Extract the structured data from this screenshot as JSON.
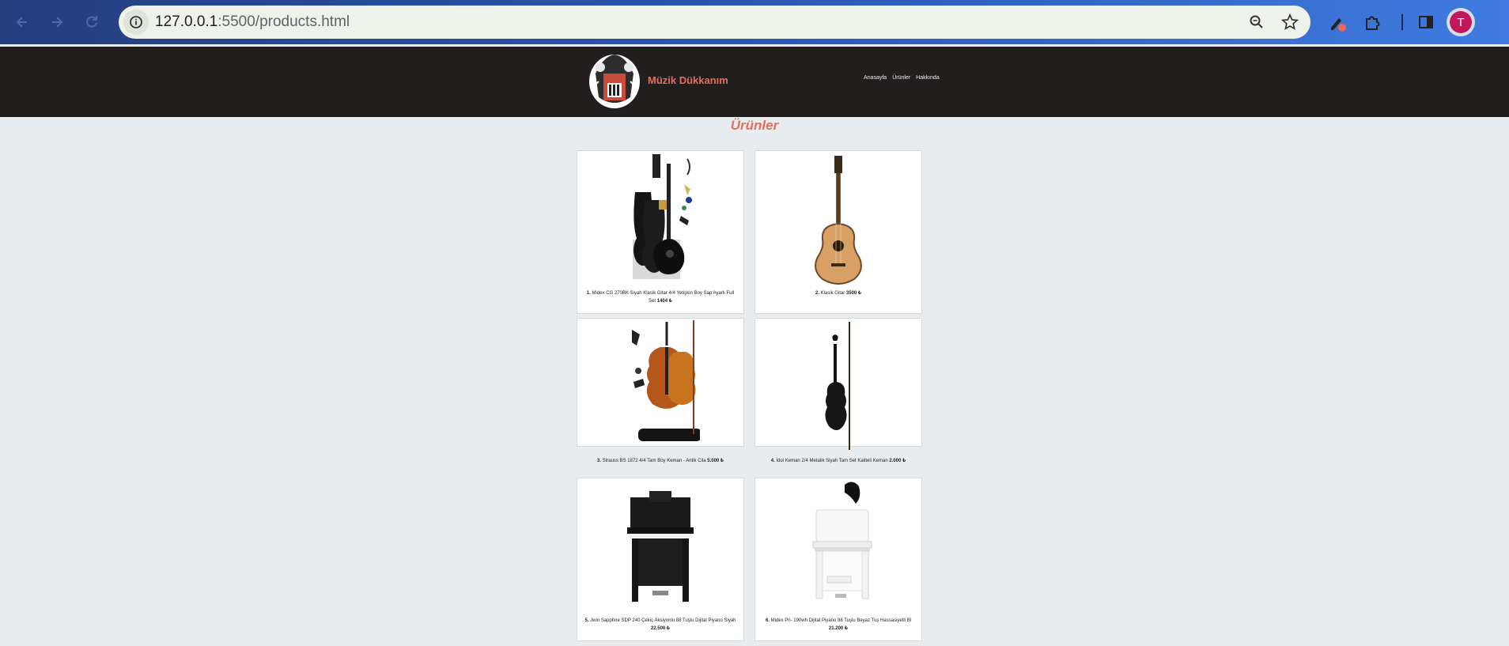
{
  "browser": {
    "url_host": "127.0.0.1",
    "url_path": ":5500/products.html",
    "avatar_letter": "T",
    "icons": [
      "back-icon",
      "forward-icon",
      "reload-icon",
      "site-info-icon",
      "zoom-icon",
      "star-icon",
      "extension-pen-icon",
      "puzzle-icon",
      "sidepanel-icon"
    ]
  },
  "site": {
    "brand": "Müzik Dükkanım",
    "menu": [
      "Anasayfa",
      "Ürünler",
      "Hakkında"
    ],
    "accent": "#e46f5e",
    "header_bg": "#221e1e"
  },
  "page": {
    "title": "Ürünler"
  },
  "products": [
    {
      "num": "1.",
      "name": "Midex CG 270BK Siyah Klasik Gitar 4/4 Yetişkin Boy Sap Ayarlı Full Set",
      "price": "1404 ₺",
      "image": "guitar-set"
    },
    {
      "num": "2.",
      "name": "Klasik Gitar",
      "price": "3500 ₺",
      "image": "classical-guitar"
    },
    {
      "num": "3.",
      "name": "Strauss BS 1872 4/4 Tam Boy Keman - Antik Cila",
      "price": "5.000 ₺",
      "image": "violin-set"
    },
    {
      "num": "4.",
      "name": "İdol Keman 2/4 Metalik Siyah Tam Set Kaliteli Keman",
      "price": "2.000 ₺",
      "image": "black-violin"
    },
    {
      "num": "5.",
      "name": "Jwin Sapphire SDP 240 Çekiç Aksiyonlu 88 Tuşlu Dijital Piyano Siyah",
      "price": "22.500 ₺",
      "image": "black-piano"
    },
    {
      "num": "6.",
      "name": "Midex Pri- 190wh Dijital Piyano 88 Tuşlu Beyaz Tuş Hassasiyetli Bl",
      "price": "21.200 ₺",
      "image": "white-piano"
    }
  ]
}
